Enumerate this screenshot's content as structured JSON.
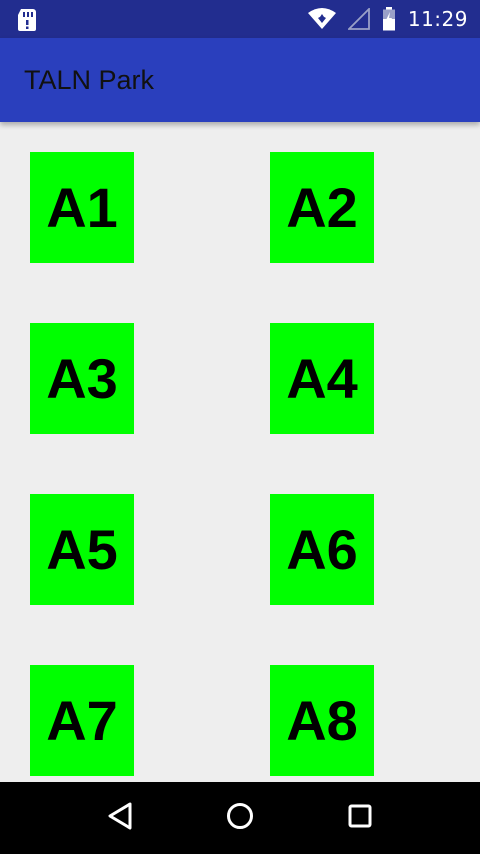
{
  "status_bar": {
    "time": "11:29",
    "icons": [
      "sd-card-icon",
      "wifi-icon",
      "cell-signal-icon",
      "battery-icon"
    ],
    "background": "#222d8f"
  },
  "app_bar": {
    "title": "TALN Park",
    "background": "#2a3fbd"
  },
  "parking_spots": [
    {
      "label": "A1",
      "color": "#00ff00"
    },
    {
      "label": "A2",
      "color": "#00ff00"
    },
    {
      "label": "A3",
      "color": "#00ff00"
    },
    {
      "label": "A4",
      "color": "#00ff00"
    },
    {
      "label": "A5",
      "color": "#00ff00"
    },
    {
      "label": "A6",
      "color": "#00ff00"
    },
    {
      "label": "A7",
      "color": "#00ff00"
    },
    {
      "label": "A8",
      "color": "#00ff00"
    }
  ],
  "nav_bar": {
    "buttons": [
      "back-icon",
      "home-icon",
      "recents-icon"
    ]
  }
}
